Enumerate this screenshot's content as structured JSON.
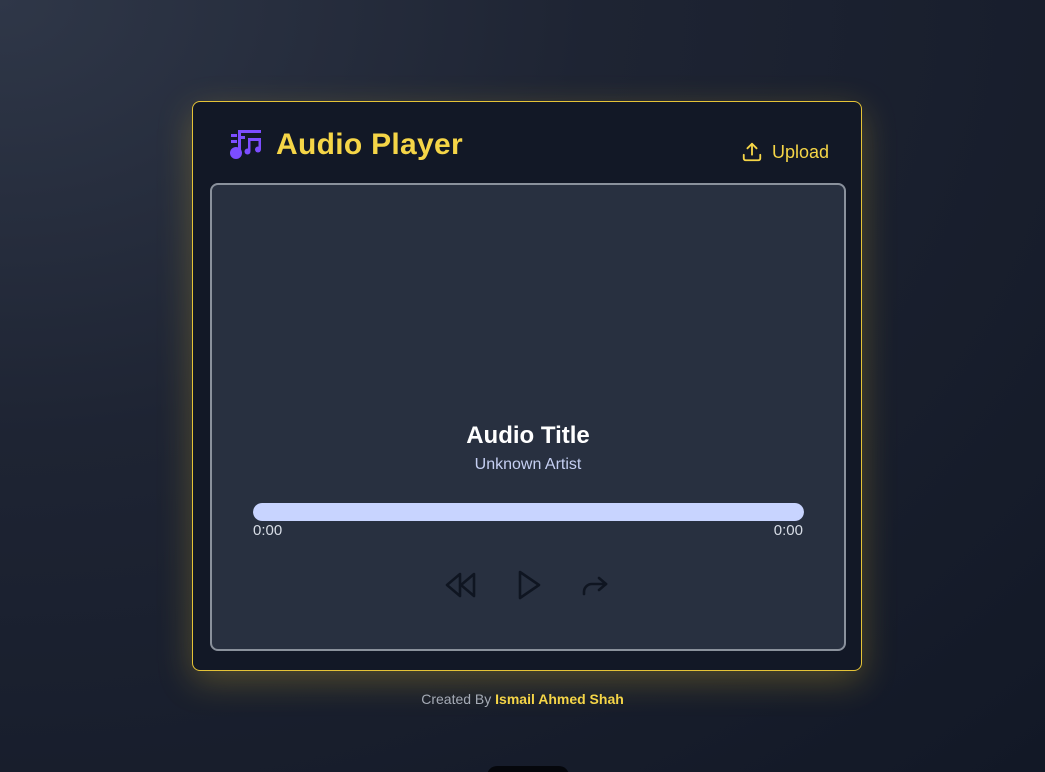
{
  "header": {
    "app_title": "Audio Player",
    "logo_icon": "music-notes-icon",
    "upload_label": "Upload",
    "upload_icon": "upload-icon"
  },
  "track": {
    "title": "Audio Title",
    "artist": "Unknown Artist"
  },
  "progress": {
    "current_time": "0:00",
    "total_time": "0:00",
    "played_fraction": 1.0
  },
  "controls": {
    "rewind_icon": "rewind-icon",
    "play_icon": "play-icon",
    "forward_icon": "forward-icon"
  },
  "footer": {
    "prefix": "Created By",
    "author": "Ismail Ahmed Shah"
  },
  "colors": {
    "accent": "#f5d547",
    "card_border": "#e5c337",
    "logo": "#7c4dff",
    "panel_bg": "#283040",
    "progress_fill": "#c8d4ff",
    "control_icons": "#0f1521"
  }
}
